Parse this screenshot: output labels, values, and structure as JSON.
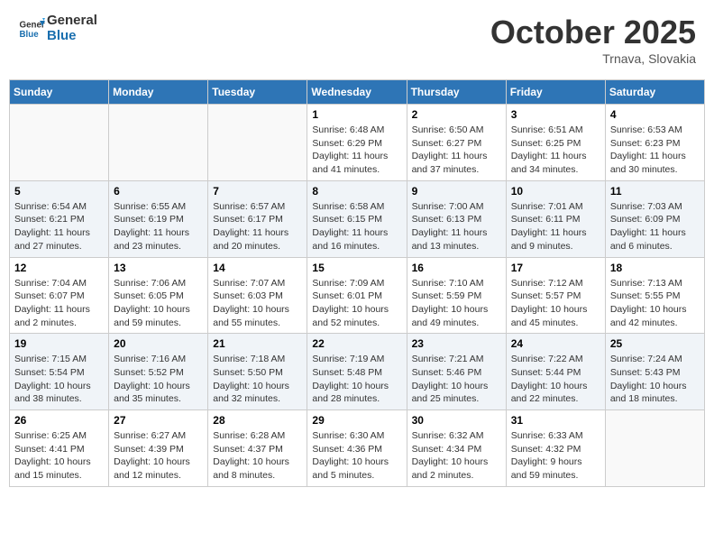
{
  "header": {
    "logo_line1": "General",
    "logo_line2": "Blue",
    "month": "October 2025",
    "location": "Trnava, Slovakia"
  },
  "days_of_week": [
    "Sunday",
    "Monday",
    "Tuesday",
    "Wednesday",
    "Thursday",
    "Friday",
    "Saturday"
  ],
  "weeks": [
    {
      "days": [
        {
          "num": "",
          "info": ""
        },
        {
          "num": "",
          "info": ""
        },
        {
          "num": "",
          "info": ""
        },
        {
          "num": "1",
          "info": "Sunrise: 6:48 AM\nSunset: 6:29 PM\nDaylight: 11 hours\nand 41 minutes."
        },
        {
          "num": "2",
          "info": "Sunrise: 6:50 AM\nSunset: 6:27 PM\nDaylight: 11 hours\nand 37 minutes."
        },
        {
          "num": "3",
          "info": "Sunrise: 6:51 AM\nSunset: 6:25 PM\nDaylight: 11 hours\nand 34 minutes."
        },
        {
          "num": "4",
          "info": "Sunrise: 6:53 AM\nSunset: 6:23 PM\nDaylight: 11 hours\nand 30 minutes."
        }
      ]
    },
    {
      "days": [
        {
          "num": "5",
          "info": "Sunrise: 6:54 AM\nSunset: 6:21 PM\nDaylight: 11 hours\nand 27 minutes."
        },
        {
          "num": "6",
          "info": "Sunrise: 6:55 AM\nSunset: 6:19 PM\nDaylight: 11 hours\nand 23 minutes."
        },
        {
          "num": "7",
          "info": "Sunrise: 6:57 AM\nSunset: 6:17 PM\nDaylight: 11 hours\nand 20 minutes."
        },
        {
          "num": "8",
          "info": "Sunrise: 6:58 AM\nSunset: 6:15 PM\nDaylight: 11 hours\nand 16 minutes."
        },
        {
          "num": "9",
          "info": "Sunrise: 7:00 AM\nSunset: 6:13 PM\nDaylight: 11 hours\nand 13 minutes."
        },
        {
          "num": "10",
          "info": "Sunrise: 7:01 AM\nSunset: 6:11 PM\nDaylight: 11 hours\nand 9 minutes."
        },
        {
          "num": "11",
          "info": "Sunrise: 7:03 AM\nSunset: 6:09 PM\nDaylight: 11 hours\nand 6 minutes."
        }
      ]
    },
    {
      "days": [
        {
          "num": "12",
          "info": "Sunrise: 7:04 AM\nSunset: 6:07 PM\nDaylight: 11 hours\nand 2 minutes."
        },
        {
          "num": "13",
          "info": "Sunrise: 7:06 AM\nSunset: 6:05 PM\nDaylight: 10 hours\nand 59 minutes."
        },
        {
          "num": "14",
          "info": "Sunrise: 7:07 AM\nSunset: 6:03 PM\nDaylight: 10 hours\nand 55 minutes."
        },
        {
          "num": "15",
          "info": "Sunrise: 7:09 AM\nSunset: 6:01 PM\nDaylight: 10 hours\nand 52 minutes."
        },
        {
          "num": "16",
          "info": "Sunrise: 7:10 AM\nSunset: 5:59 PM\nDaylight: 10 hours\nand 49 minutes."
        },
        {
          "num": "17",
          "info": "Sunrise: 7:12 AM\nSunset: 5:57 PM\nDaylight: 10 hours\nand 45 minutes."
        },
        {
          "num": "18",
          "info": "Sunrise: 7:13 AM\nSunset: 5:55 PM\nDaylight: 10 hours\nand 42 minutes."
        }
      ]
    },
    {
      "days": [
        {
          "num": "19",
          "info": "Sunrise: 7:15 AM\nSunset: 5:54 PM\nDaylight: 10 hours\nand 38 minutes."
        },
        {
          "num": "20",
          "info": "Sunrise: 7:16 AM\nSunset: 5:52 PM\nDaylight: 10 hours\nand 35 minutes."
        },
        {
          "num": "21",
          "info": "Sunrise: 7:18 AM\nSunset: 5:50 PM\nDaylight: 10 hours\nand 32 minutes."
        },
        {
          "num": "22",
          "info": "Sunrise: 7:19 AM\nSunset: 5:48 PM\nDaylight: 10 hours\nand 28 minutes."
        },
        {
          "num": "23",
          "info": "Sunrise: 7:21 AM\nSunset: 5:46 PM\nDaylight: 10 hours\nand 25 minutes."
        },
        {
          "num": "24",
          "info": "Sunrise: 7:22 AM\nSunset: 5:44 PM\nDaylight: 10 hours\nand 22 minutes."
        },
        {
          "num": "25",
          "info": "Sunrise: 7:24 AM\nSunset: 5:43 PM\nDaylight: 10 hours\nand 18 minutes."
        }
      ]
    },
    {
      "days": [
        {
          "num": "26",
          "info": "Sunrise: 6:25 AM\nSunset: 4:41 PM\nDaylight: 10 hours\nand 15 minutes."
        },
        {
          "num": "27",
          "info": "Sunrise: 6:27 AM\nSunset: 4:39 PM\nDaylight: 10 hours\nand 12 minutes."
        },
        {
          "num": "28",
          "info": "Sunrise: 6:28 AM\nSunset: 4:37 PM\nDaylight: 10 hours\nand 8 minutes."
        },
        {
          "num": "29",
          "info": "Sunrise: 6:30 AM\nSunset: 4:36 PM\nDaylight: 10 hours\nand 5 minutes."
        },
        {
          "num": "30",
          "info": "Sunrise: 6:32 AM\nSunset: 4:34 PM\nDaylight: 10 hours\nand 2 minutes."
        },
        {
          "num": "31",
          "info": "Sunrise: 6:33 AM\nSunset: 4:32 PM\nDaylight: 9 hours\nand 59 minutes."
        },
        {
          "num": "",
          "info": ""
        }
      ]
    }
  ]
}
